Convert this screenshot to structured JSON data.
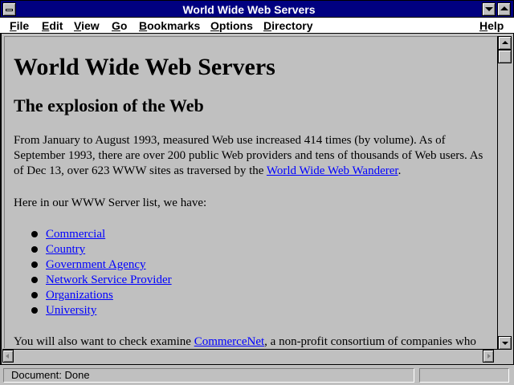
{
  "window": {
    "title": "World Wide Web Servers"
  },
  "menu": {
    "file": "File",
    "edit": "Edit",
    "view": "View",
    "go": "Go",
    "bookmarks": "Bookmarks",
    "options": "Options",
    "directory": "Directory",
    "help": "Help"
  },
  "page": {
    "heading": "World Wide Web Servers",
    "subheading": "The explosion of the Web",
    "para1_text": "From January to August 1993, measured Web use increased 414 times (by volume). As of September 1993, there are over 200 public Web providers and tens of thousands of Web users. As of Dec 13, over 623 WWW sites as traversed by the ",
    "para1_link": "World Wide Web Wanderer",
    "para1_end": ".",
    "para2": "Here in our WWW Server list, we have:",
    "list": [
      "Commercial",
      "Country",
      "Government Agency",
      "Network Service Provider",
      "Organizations",
      "University"
    ],
    "para3_text": "You will also want to check examine ",
    "para3_link": "CommerceNet",
    "para3_end": ", a non-profit consortium of companies who"
  },
  "status": {
    "text": "Document: Done"
  },
  "colors": {
    "titlebar": "#000080",
    "chrome": "#c0c0c0",
    "link": "#0000ff"
  }
}
